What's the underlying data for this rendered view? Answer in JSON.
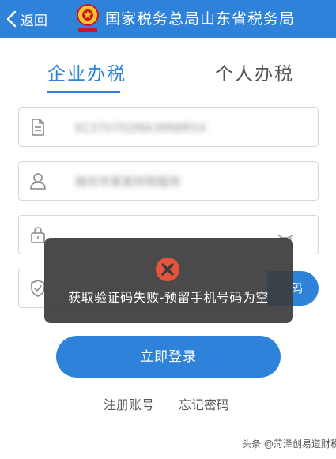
{
  "header": {
    "back_label": "返回",
    "title": "国家税务总局山东省税务局",
    "background_color": "#2e82d9",
    "emblem_icon": "tax-emblem-icon"
  },
  "tabs": [
    {
      "label": "企业办税",
      "active": true
    },
    {
      "label": "个人办税",
      "active": false
    }
  ],
  "form": {
    "taxpayer_id": {
      "value": "91370702MA3MWR5X",
      "icon": "document-icon"
    },
    "username": {
      "value": "潍坊市某某财税服务",
      "icon": "user-icon"
    },
    "password": {
      "value": "",
      "icon": "lock-icon",
      "visibility_icon": "eye-closed-icon"
    },
    "verification_code": {
      "value": "",
      "icon": "shield-icon"
    },
    "get_code_label": "码"
  },
  "login_button": "立即登录",
  "links": {
    "register": "注册账号",
    "forgot_password": "忘记密码"
  },
  "toast": {
    "icon": "error-circle-icon",
    "message": "获取验证码失败-预留手机号码为空",
    "icon_color": "#e8533c"
  },
  "watermark": "头条 @菏泽创易道财税",
  "accent_color": "#2e82d9"
}
